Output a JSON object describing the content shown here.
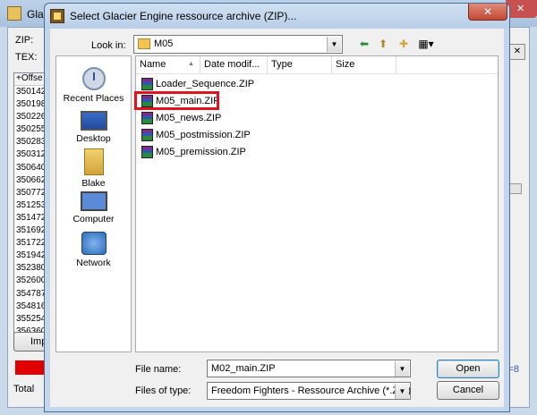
{
  "background_window": {
    "title": "Glac",
    "zip_label": "ZIP:",
    "tex_label": "TEX:",
    "list_header": "+Offse",
    "list_rows": [
      "350142",
      "350198",
      "350226",
      "350255",
      "350283",
      "350312",
      "350640",
      "350662",
      "350772",
      "351253",
      "351472",
      "351692",
      "351722",
      "351942",
      "352380",
      "352600",
      "354787",
      "354816",
      "355254",
      "356360"
    ],
    "import_button": "Imp",
    "total_label": "Total",
    "right_text": "l=8"
  },
  "dialog": {
    "title": "Select Glacier Engine ressource archive (ZIP)...",
    "look_in_label": "Look in:",
    "look_in_value": "M05",
    "places": [
      {
        "label": "Recent Places",
        "icon": "recent-places-icon"
      },
      {
        "label": "Desktop",
        "icon": "desktop-icon"
      },
      {
        "label": "Blake",
        "icon": "user-folder-icon"
      },
      {
        "label": "Computer",
        "icon": "computer-icon"
      },
      {
        "label": "Network",
        "icon": "network-icon"
      }
    ],
    "columns": [
      "Name",
      "Date modif...",
      "Type",
      "Size"
    ],
    "files": [
      "Loader_Sequence.ZIP",
      "M05_main.ZIP",
      "M05_news.ZIP",
      "M05_postmission.ZIP",
      "M05_premission.ZIP"
    ],
    "highlighted_file": "M05_main.ZIP",
    "file_name_label": "File name:",
    "file_name_value": "M02_main.ZIP",
    "files_of_type_label": "Files of type:",
    "files_of_type_value": "Freedom Fighters - Ressource Archive (*.ZIP)",
    "open_button": "Open",
    "cancel_button": "Cancel",
    "highlight_color": "#e0141e"
  }
}
